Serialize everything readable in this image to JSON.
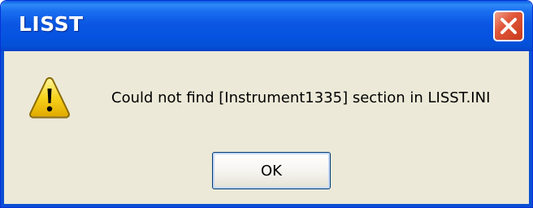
{
  "window": {
    "title": "LISST"
  },
  "dialog": {
    "icon": "warning-icon",
    "message": "Could not find [Instrument1335] section in LISST.INI",
    "ok_label": "OK"
  },
  "colors": {
    "titlebar": "#0553e0",
    "close_button": "#e0573a",
    "dialog_bg": "#ece9d8",
    "warning_yellow": "#f7d21a"
  }
}
